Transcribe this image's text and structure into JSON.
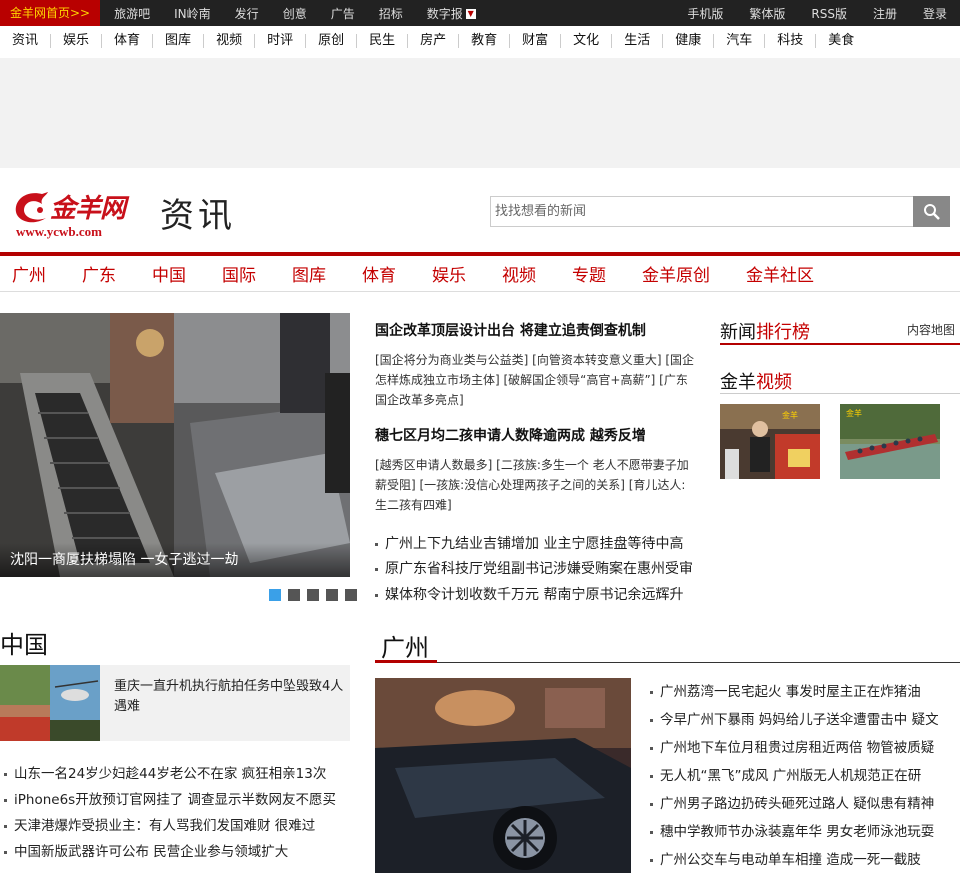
{
  "topbar": {
    "home": "金羊网首页>>",
    "left_links": [
      "旅游吧",
      "IN岭南",
      "发行",
      "创意",
      "广告",
      "招标",
      "数字报"
    ],
    "right_links": [
      "手机版",
      "繁体版",
      "RSS版",
      "注册",
      "登录"
    ]
  },
  "nav2": [
    "资讯",
    "娱乐",
    "体育",
    "图库",
    "视频",
    "时评",
    "原创",
    "民生",
    "房产",
    "教育",
    "财富",
    "文化",
    "生活",
    "健康",
    "汽车",
    "科技",
    "美食"
  ],
  "header": {
    "logo_text": "金羊网",
    "logo_url": "www.ycwb.com",
    "channel": "资讯",
    "search_placeholder": "找找想看的新闻"
  },
  "nav3": [
    "广州",
    "广东",
    "中国",
    "国际",
    "图库",
    "体育",
    "娱乐",
    "视频",
    "专题",
    "金羊原创",
    "金羊社区"
  ],
  "slideshow": {
    "caption": "沈阳一商厦扶梯塌陷 一女子逃过一劫",
    "slide_count": 5,
    "active_index": 0
  },
  "headlines": [
    {
      "title": "国企改革顶层设计出台 将建立追责倒查机制",
      "sub": "[国企将分为商业类与公益类] [向管资本转变意义重大] [国企怎样炼成独立市场主体] [破解国企领导“高官+高薪”] [广东国企改革多亮点]"
    },
    {
      "title": "穗七区月均二孩申请人数降逾两成 越秀反增",
      "sub": "[越秀区申请人数最多] [二孩族:多生一个 老人不愿带妻子加薪受阻] [一孩族:没信心处理两孩子之间的关系] [育儿达人:生二孩有四难]"
    }
  ],
  "bullets": [
    "广州上下九结业吉铺增加 业主宁愿挂盘等待中高",
    "原广东省科技厅党组副书记涉嫌受贿案在惠州受审",
    "媒体称令计划收数千万元 帮南宁原书记余远辉升"
  ],
  "right": {
    "rank_title_a": "新闻",
    "rank_title_b": "排行榜",
    "sitemap": "内容地图",
    "video_title_a": "金羊",
    "video_title_b": "视频"
  },
  "china": {
    "title": "中国",
    "feature": "重庆一直升机执行航拍任务中坠毁致4人遇难",
    "list": [
      "山东一名24岁少妇趁44岁老公不在家 疯狂相亲13次",
      "iPhone6s开放预订官网挂了 调查显示半数网友不愿买",
      "天津港爆炸受损业主：有人骂我们发国难财 很难过",
      "中国新版武器许可公布 民营企业参与领域扩大"
    ]
  },
  "guangzhou": {
    "title": "广州",
    "list": [
      "广州荔湾一民宅起火 事发时屋主正在炸猪油",
      "今早广州下暴雨 妈妈给儿子送伞遭雷击中 疑文",
      "广州地下车位月租贵过房租近两倍 物管被质疑",
      "无人机“黑飞”成风 广州版无人机规范正在研",
      "广州男子路边扔砖头砸死过路人 疑似患有精神",
      "穗中学教师节办泳装嘉年华 男女老师泳池玩耍",
      "广州公交车与电动单车相撞 造成一死一截肢"
    ]
  },
  "colors": {
    "brand_red": "#b30000",
    "topbar_bg": "#222222",
    "accent_blue": "#3aa0e8"
  }
}
